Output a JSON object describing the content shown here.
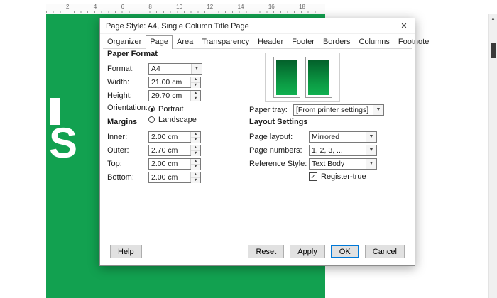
{
  "window": {
    "title": "Page Style: A4, Single Column Title Page",
    "close_icon": "✕"
  },
  "tabs": [
    {
      "label": "Organizer"
    },
    {
      "label": "Page"
    },
    {
      "label": "Area"
    },
    {
      "label": "Transparency"
    },
    {
      "label": "Header"
    },
    {
      "label": "Footer"
    },
    {
      "label": "Borders"
    },
    {
      "label": "Columns"
    },
    {
      "label": "Footnote"
    }
  ],
  "paper_format": {
    "section_title": "Paper Format",
    "format_label": "Format:",
    "format_value": "A4",
    "width_label": "Width:",
    "width_value": "21.00 cm",
    "height_label": "Height:",
    "height_value": "29.70 cm",
    "orientation_label": "Orientation:",
    "portrait_label": "Portrait",
    "landscape_label": "Landscape",
    "paper_tray_label": "Paper tray:",
    "paper_tray_value": "[From printer settings]"
  },
  "margins": {
    "section_title": "Margins",
    "fields": [
      {
        "label": "Inner:",
        "value": "2.00 cm"
      },
      {
        "label": "Outer:",
        "value": "2.70 cm"
      },
      {
        "label": "Top:",
        "value": "2.00 cm"
      },
      {
        "label": "Bottom:",
        "value": "2.00 cm"
      }
    ]
  },
  "layout_settings": {
    "section_title": "Layout Settings",
    "page_layout_label": "Page layout:",
    "page_layout_value": "Mirrored",
    "page_numbers_label": "Page numbers:",
    "page_numbers_value": "1, 2, 3, ...",
    "reference_style_label": "Reference Style:",
    "reference_style_value": "Text Body",
    "register_true_label": "Register-true",
    "register_true_check": "✓"
  },
  "buttons": {
    "help": "Help",
    "reset": "Reset",
    "apply": "Apply",
    "ok": "OK",
    "cancel": "Cancel"
  },
  "ruler": {
    "numbers": [
      "2",
      "4",
      "6",
      "8",
      "10",
      "12",
      "14",
      "16",
      "18"
    ]
  },
  "document": {
    "heading_fragment": "S"
  },
  "icons": {
    "dropdown_arrow": "▼",
    "spin_up": "▲",
    "spin_down": "▼",
    "scroll_up": "▲"
  },
  "colors": {
    "page_green": "#12a150",
    "thumb_green_dark": "#035f2a",
    "ok_accent": "#0078d7"
  }
}
